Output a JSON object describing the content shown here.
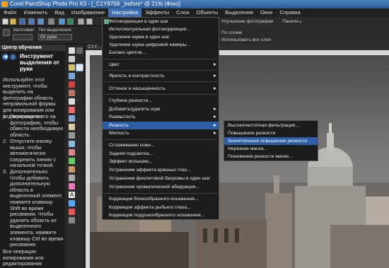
{
  "window": {
    "title": "Corel PaintShop Photo Pro X3 - [_C1Y9758 _before* @  21% (Фон)]"
  },
  "menubar": [
    {
      "label": "Файл"
    },
    {
      "label": "Изменить"
    },
    {
      "label": "Вид"
    },
    {
      "label": "Изображение"
    },
    {
      "label": "Настройка"
    },
    {
      "label": "Эффекты"
    },
    {
      "label": "Слои"
    },
    {
      "label": "Объекты"
    },
    {
      "label": "Выделения"
    },
    {
      "label": "Окно"
    },
    {
      "label": "Справка"
    }
  ],
  "optbar": {
    "preset_label": "Заготовки:",
    "mode_label": "Тип выделения:",
    "mode_value": "От руки",
    "photo_improve": "Улучшение фотографии",
    "panels": "Панели",
    "sample_merged": "По слоям",
    "use_all_layers": "Использовать все слои"
  },
  "learning_center": {
    "header": "Центр обучения",
    "title": "Инструмент выделения от руки",
    "intro": "Используйте этот инструмент, чтобы выделить на фотографии область неправильной формы для копирования или редактирования.",
    "steps": [
      {
        "n": "1.",
        "text": "Перетащите его на фотографию, чтобы обвести необходимую область."
      },
      {
        "n": "2.",
        "text": "Отпустите кнопку мыши, чтобы автоматически соединить линию с начальной точкой."
      },
      {
        "n": "3.",
        "text": "Дополнительно: Чтобы добавить дополнительную область в выделенный элемент, нажмите клавишу Shift во время рисования. Чтобы удалить область из выделенного элемента, нажмите клавишу Ctrl во время рисования."
      }
    ],
    "footer": "Все операции копирования или редактирования"
  },
  "canvas": {
    "tab_label": "C1Y..."
  },
  "adjust_menu": {
    "items": [
      {
        "label": "Фотокоррекция в один шаг",
        "sub": false
      },
      {
        "label": "Интеллектуальная фотокоррекция...",
        "sub": false
      },
      {
        "label": "Удаление шума в один шаг",
        "sub": false
      },
      {
        "label": "Удаление шума цифровой камеры...",
        "sub": false
      },
      {
        "label": "Баланс цветов...",
        "sub": false
      },
      {
        "label": "Цвет",
        "sub": true
      },
      {
        "label": "Яркость и контрастность",
        "sub": true
      },
      {
        "label": "Оттенок и насыщенность",
        "sub": true
      },
      {
        "label": "Глубина резкости...",
        "sub": false
      },
      {
        "label": "Добавить/удалить шум",
        "sub": true
      },
      {
        "label": "Размытость",
        "sub": true
      },
      {
        "label": "Резкость",
        "sub": true
      },
      {
        "label": "Мягкость",
        "sub": true
      },
      {
        "label": "Сглаживание кожи...",
        "sub": false
      },
      {
        "label": "Задняя подсветка...",
        "sub": false
      },
      {
        "label": "Эффект вспышки...",
        "sub": false
      },
      {
        "label": "Устранение эффекта красных глаз...",
        "sub": false
      },
      {
        "label": "Устранение фиолетовой бахромы в один шаг",
        "sub": false
      },
      {
        "label": "Устранение хроматической аберрации...",
        "sub": false
      },
      {
        "label": "Коррекция бочкообразного искажения...",
        "sub": false
      },
      {
        "label": "Коррекция эффекта рыбьего глаза...",
        "sub": false
      },
      {
        "label": "Коррекция подушкообразного искажения...",
        "sub": false
      }
    ]
  },
  "sharpen_menu": {
    "items": [
      {
        "label": "Высокочастотная фильтрация..."
      },
      {
        "label": "Повышение резкости"
      },
      {
        "label": "Значительное повышение резкости"
      },
      {
        "label": "Нерезкая маска..."
      },
      {
        "label": "Понижение резкости маски..."
      }
    ],
    "highlighted_index": 2
  },
  "colors": {
    "accent": "#2d5ea6",
    "menu_bg": "#1c1c1c"
  }
}
